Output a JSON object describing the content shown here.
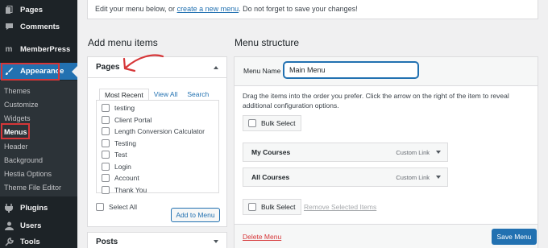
{
  "sidebar": {
    "items": [
      {
        "label": "Pages",
        "icon": "pages-icon"
      },
      {
        "label": "Comments",
        "icon": "comments-icon"
      },
      {
        "label": "MemberPress",
        "icon": "memberpress-icon"
      },
      {
        "label": "Appearance",
        "icon": "appearance-icon"
      },
      {
        "label": "Plugins",
        "icon": "plugins-icon"
      },
      {
        "label": "Users",
        "icon": "users-icon"
      },
      {
        "label": "Tools",
        "icon": "tools-icon"
      }
    ],
    "submenu": [
      "Themes",
      "Customize",
      "Widgets",
      "Menus",
      "Header",
      "Background",
      "Hestia Options",
      "Theme File Editor"
    ]
  },
  "notice": {
    "prefix": "Edit your menu below, or ",
    "link": "create a new menu",
    "suffix": ". Do not forget to save your changes!"
  },
  "left": {
    "heading": "Add menu items",
    "pages_panel": {
      "title": "Pages",
      "tabs": [
        "Most Recent",
        "View All",
        "Search"
      ],
      "items": [
        "testing",
        "Client Portal",
        "Length Conversion Calculator",
        "Testing",
        "Test",
        "Login",
        "Account",
        "Thank You"
      ],
      "select_all": "Select All",
      "add_button": "Add to Menu"
    },
    "posts_panel": {
      "title": "Posts"
    }
  },
  "right": {
    "heading": "Menu structure",
    "menu_name_label": "Menu Name",
    "menu_name_value": "Main Menu",
    "instructions": "Drag the items into the order you prefer. Click the arrow on the right of the item to reveal additional configuration options.",
    "bulk_select": "Bulk Select",
    "menu_items": [
      {
        "title": "My Courses",
        "type": "Custom Link"
      },
      {
        "title": "All Courses",
        "type": "Custom Link"
      }
    ],
    "remove_selected": "Remove Selected Items",
    "delete_menu": "Delete Menu",
    "save_menu": "Save Menu"
  },
  "colors": {
    "accent": "#2271b1",
    "sidebar": "#1d2327",
    "annotation": "#d63638"
  }
}
